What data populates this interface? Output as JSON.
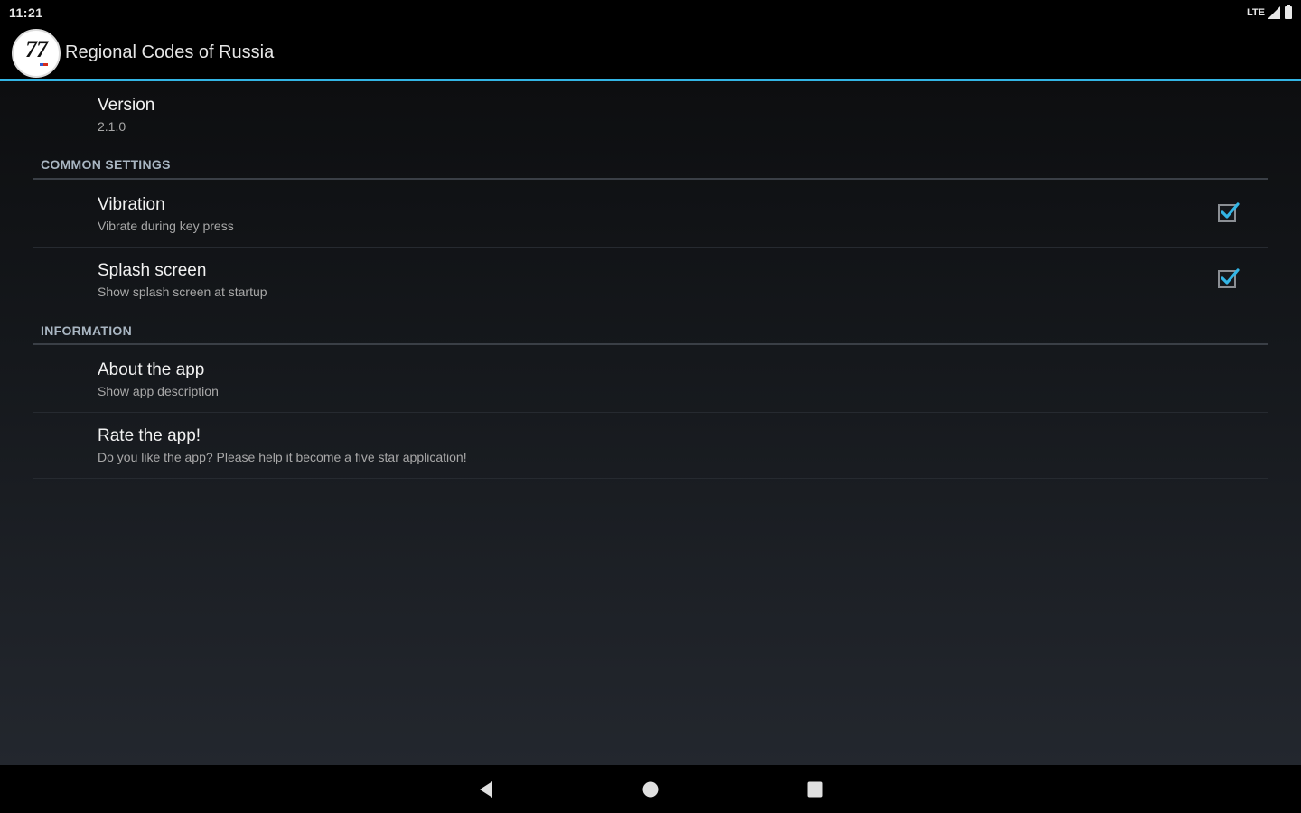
{
  "status_bar": {
    "time": "11:21",
    "network": "LTE"
  },
  "action_bar": {
    "logo_number": "77",
    "title": "Regional Codes of Russia"
  },
  "preferences": {
    "version": {
      "title": "Version",
      "summary": "2.1.0"
    },
    "categories": {
      "common": "COMMON SETTINGS",
      "information": "INFORMATION"
    },
    "vibration": {
      "title": "Vibration",
      "summary": "Vibrate during key press",
      "checked": true
    },
    "splash": {
      "title": "Splash screen",
      "summary": "Show splash screen at startup",
      "checked": true
    },
    "about": {
      "title": "About the app",
      "summary": "Show app description"
    },
    "rate": {
      "title": "Rate the app!",
      "summary": "Do you like the app? Please help it become a five star application!"
    }
  },
  "nav_bar": {
    "buttons": [
      "back-icon",
      "home-icon",
      "recents-icon"
    ]
  },
  "colors": {
    "accent": "#33b5e5",
    "background": "#000000",
    "category_text": "#a9b6c2"
  }
}
